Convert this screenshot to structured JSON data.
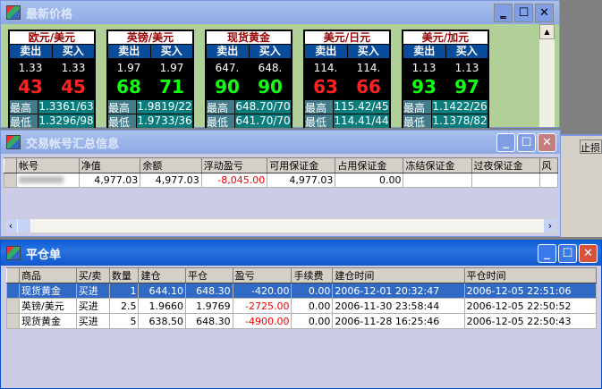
{
  "price_window": {
    "title": "最新价格",
    "sell_label": "卖出",
    "buy_label": "买入",
    "high_label": "最高",
    "low_label": "最低",
    "cards": [
      {
        "name": "欧元/美元",
        "sell_prefix": "1.33",
        "buy_prefix": "1.33",
        "sell_big": "43",
        "buy_big": "45",
        "dir": "red",
        "high": "1.3361/63",
        "low": "1.3296/98"
      },
      {
        "name": "英镑/美元",
        "sell_prefix": "1.97",
        "buy_prefix": "1.97",
        "sell_big": "68",
        "buy_big": "71",
        "dir": "grn",
        "high": "1.9819/22",
        "low": "1.9733/36"
      },
      {
        "name": "现货黄金",
        "sell_prefix": "647.",
        "buy_prefix": "648.",
        "sell_big": "90",
        "buy_big": "90",
        "dir": "grn",
        "high": "648.70/70",
        "low": "641.70/70"
      },
      {
        "name": "美元/日元",
        "sell_prefix": "114.",
        "buy_prefix": "114.",
        "sell_big": "63",
        "buy_big": "66",
        "dir": "red",
        "high": "115.42/45",
        "low": "114.41/44"
      },
      {
        "name": "美元/加元",
        "sell_prefix": "1.13",
        "buy_prefix": "1.13",
        "sell_big": "93",
        "buy_big": "97",
        "dir": "grn",
        "high": "1.1422/26",
        "low": "1.1378/82"
      }
    ]
  },
  "account_window": {
    "title": "交易帐号汇总信息",
    "columns": [
      "帐号",
      "净值",
      "余额",
      "浮动盈亏",
      "可用保证金",
      "占用保证金",
      "冻结保证金",
      "过夜保证金",
      "风"
    ],
    "row": [
      "",
      "4,977.03",
      "4,977.03",
      "-8,045.00",
      "4,977.03",
      "0.00",
      "",
      ""
    ]
  },
  "background_window": {
    "column": "止损"
  },
  "close_window": {
    "title": "平仓单",
    "columns": [
      "商品",
      "买/卖",
      "数量",
      "建仓",
      "平仓",
      "盈亏",
      "手续费",
      "建仓时间",
      "平仓时间"
    ],
    "rows": [
      [
        "现货黄金",
        "买进",
        "1",
        "644.10",
        "648.30",
        "-420.00",
        "0.00",
        "2006-12-01 20:32:47",
        "2006-12-05 22:51:06"
      ],
      [
        "英镑/美元",
        "买进",
        "2.5",
        "1.9660",
        "1.9769",
        "-2725.00",
        "0.00",
        "2006-11-30 23:58:44",
        "2006-12-05 22:50:52"
      ],
      [
        "现货黄金",
        "买进",
        "5",
        "638.50",
        "648.30",
        "-4900.00",
        "0.00",
        "2006-11-28 16:25:46",
        "2006-12-05 22:50:43"
      ]
    ]
  }
}
